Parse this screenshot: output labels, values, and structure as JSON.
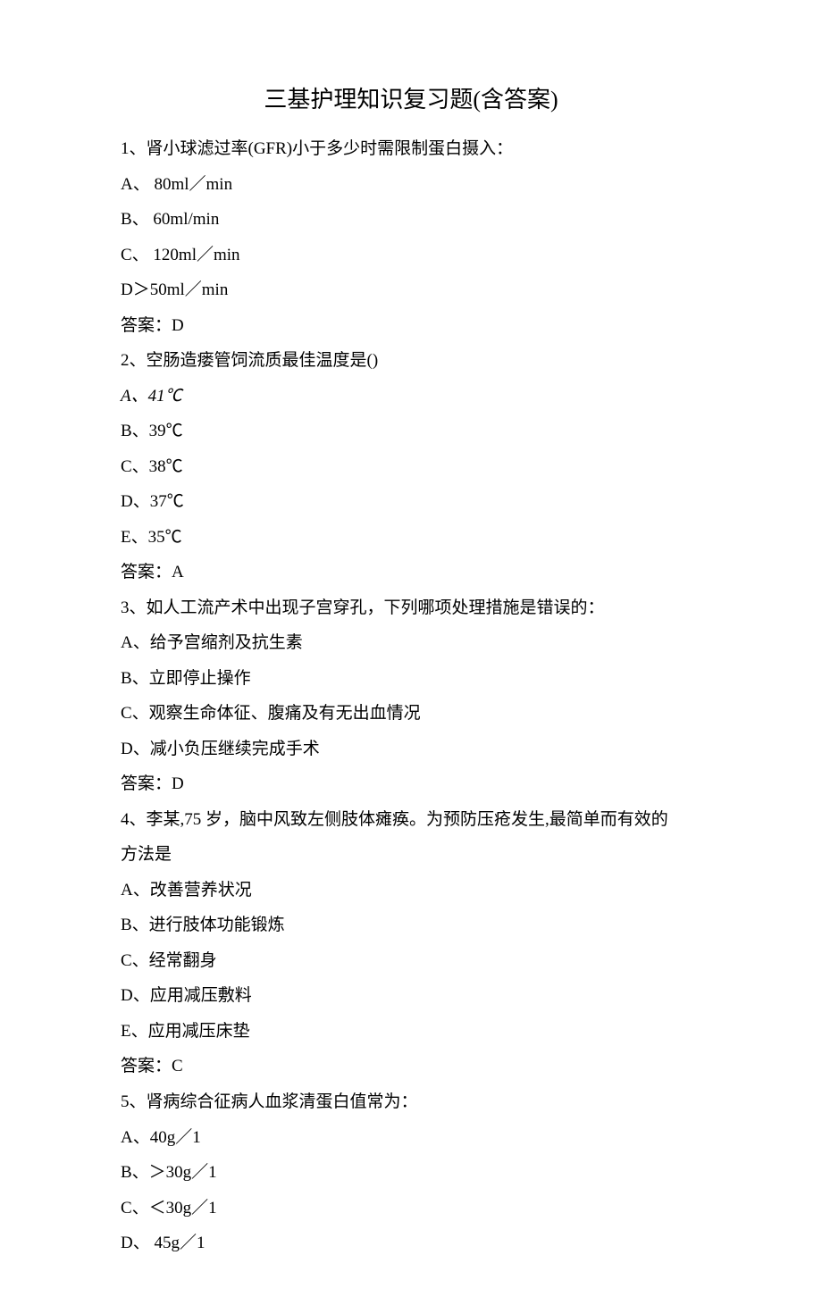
{
  "title": "三基护理知识复习题(含答案)",
  "q1": {
    "stem": "1、肾小球滤过率(GFR)小于多少时需限制蛋白摄入：",
    "a": "A、 80ml／min",
    "b": "B、 60ml/min",
    "c": "C、 120ml／min",
    "d": "D＞50ml／min",
    "ans": "答案：D"
  },
  "q2": {
    "stem": "2、空肠造瘘管饲流质最佳温度是()",
    "a": "A、41℃",
    "b": "B、39℃",
    "c": "C、38℃",
    "d": "D、37℃",
    "e": "E、35℃",
    "ans": "答案：A"
  },
  "q3": {
    "stem": "3、如人工流产术中出现子宫穿孔，下列哪项处理措施是错误的：",
    "a": "A、给予宫缩剂及抗生素",
    "b": "B、立即停止操作",
    "c": "C、观察生命体征、腹痛及有无出血情况",
    "d": "D、减小负压继续完成手术",
    "ans": "答案：D"
  },
  "q4": {
    "line1": "4、李某,75 岁，脑中风致左侧肢体瘫痪。为预防压疮发生,最简单而有效的",
    "line2": "方法是",
    "a": "A、改善营养状况",
    "b": "B、进行肢体功能锻炼",
    "c": "C、经常翻身",
    "d": "D、应用减压敷料",
    "e": "E、应用减压床垫",
    "ans": "答案：C"
  },
  "q5": {
    "stem": "5、肾病综合征病人血浆清蛋白值常为：",
    "a": "A、40g／1",
    "b": "B、＞30g／1",
    "c": "C、＜30g／1",
    "d": "D、 45g／1"
  }
}
